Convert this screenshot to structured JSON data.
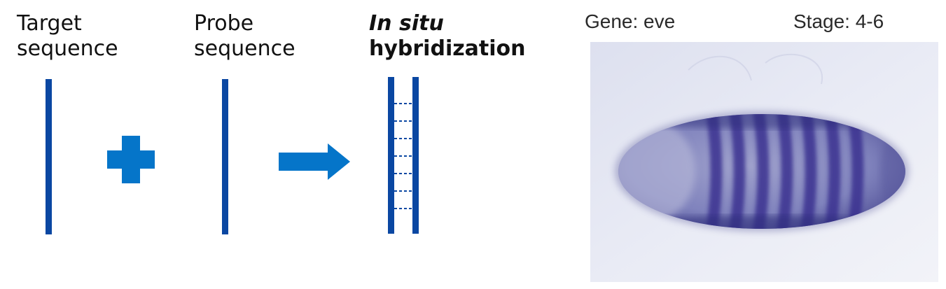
{
  "labels": {
    "target": [
      "Target",
      "sequence"
    ],
    "probe": [
      "Probe",
      "sequence"
    ],
    "ish_italic": "In situ",
    "ish_rest": "hybridization"
  },
  "photo": {
    "gene_caption": "Gene: eve",
    "stage_caption": "Stage: 4-6",
    "stripe_count": 7
  },
  "icons": {
    "plus": "plus-icon",
    "arrow": "right-arrow-icon"
  },
  "colors": {
    "strand": "#0a47a2",
    "symbol": "#0575c9",
    "stain": "#3b3390"
  }
}
